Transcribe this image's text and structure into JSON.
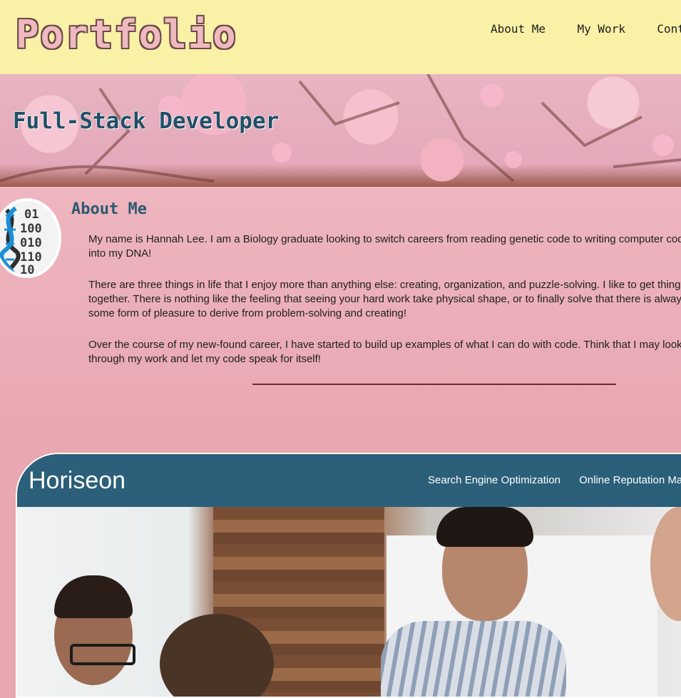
{
  "header": {
    "logo": "Portfolio",
    "nav": [
      "About Me",
      "My Work",
      "Contact"
    ]
  },
  "hero": {
    "title": "Full-Stack Developer"
  },
  "about": {
    "heading": "About Me",
    "paragraphs": [
      "My name is Hannah Lee. I am a Biology graduate looking to switch careers from reading genetic code to writing computer code into my DNA!",
      "There are three things in life that I enjoy more than anything else: creating, organization, and puzzle-solving. I like to get things together. There is nothing like the feeling that seeing your hard work take physical shape, or to finally solve that there is always some form of pleasure to derive from problem-solving and creating!",
      "Over the course of my new-found career, I have started to build up examples of what I can do with code. Think that I may look through my work and let my code speak for itself!"
    ],
    "avatar_icon": "dna-binary-icon"
  },
  "work": {
    "project_brand": "Horiseon",
    "project_nav": [
      "Search Engine Optimization",
      "Online Reputation Management"
    ]
  },
  "colors": {
    "header_bg": "#f8f1a6",
    "page_bg": "#e9a7b1",
    "accent_blue": "#2b5f7a",
    "heading_blue": "#234e66"
  }
}
